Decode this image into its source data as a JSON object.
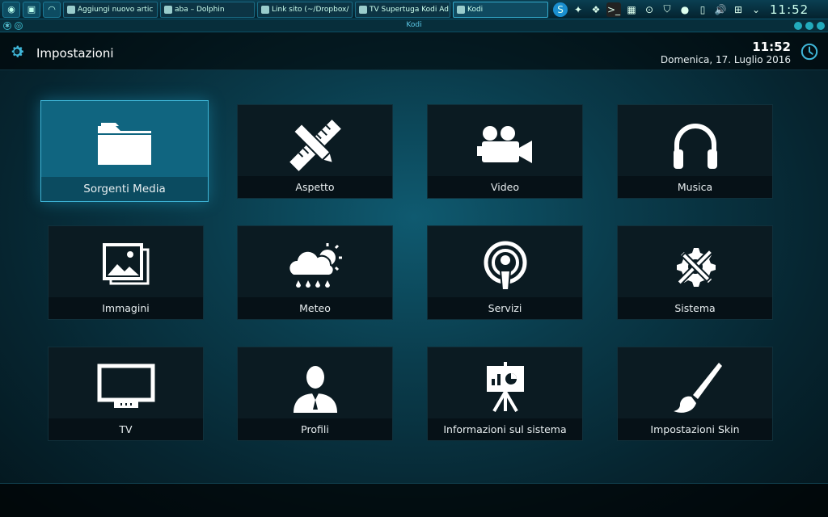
{
  "taskbar": {
    "tasks": [
      {
        "label": "Aggiungi nuovo artic"
      },
      {
        "label": "aba – Dolphin"
      },
      {
        "label": "Link sito (~/Dropbox/"
      },
      {
        "label": "TV Supertuga Kodi Ad"
      },
      {
        "label": "Kodi"
      }
    ],
    "clock": "11:52"
  },
  "window": {
    "title": "Kodi"
  },
  "header": {
    "title": "Impostazioni",
    "time": "11:52",
    "date": "Domenica, 17. Luglio 2016"
  },
  "tiles": [
    {
      "label": "Sorgenti Media",
      "icon": "folder-icon"
    },
    {
      "label": "Aspetto",
      "icon": "pencil-ruler-icon"
    },
    {
      "label": "Video",
      "icon": "video-camera-icon"
    },
    {
      "label": "Musica",
      "icon": "headphones-icon"
    },
    {
      "label": "Immagini",
      "icon": "pictures-icon"
    },
    {
      "label": "Meteo",
      "icon": "weather-icon"
    },
    {
      "label": "Servizi",
      "icon": "podcast-icon"
    },
    {
      "label": "Sistema",
      "icon": "gear-tools-icon"
    },
    {
      "label": "TV",
      "icon": "tv-icon"
    },
    {
      "label": "Profili",
      "icon": "profile-icon"
    },
    {
      "label": "Informazioni sul sistema",
      "icon": "presentation-icon"
    },
    {
      "label": "Impostazioni Skin",
      "icon": "paintbrush-icon"
    }
  ],
  "colors": {
    "accent": "#3fb6d8",
    "focus_tile": "#106580",
    "tile": "#0b1b22"
  }
}
